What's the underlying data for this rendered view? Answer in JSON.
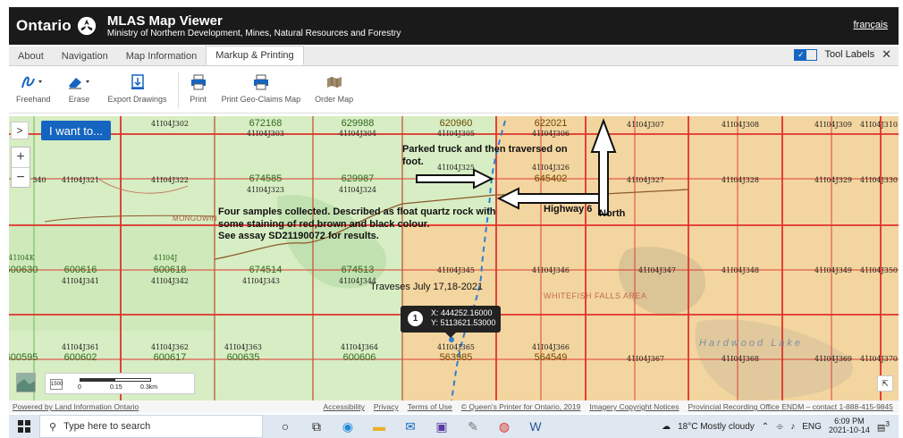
{
  "header": {
    "logo_text": "Ontario",
    "app_title": "MLAS Map Viewer",
    "subtitle": "Ministry of Northern Development, Mines, Natural Resources and Forestry",
    "language_link": "français"
  },
  "tabs": {
    "items": [
      {
        "label": "About"
      },
      {
        "label": "Navigation"
      },
      {
        "label": "Map Information"
      },
      {
        "label": "Markup & Printing"
      }
    ],
    "active": "Markup & Printing",
    "tool_labels": "Tool Labels",
    "tool_labels_checked": true,
    "close_glyph": "✕"
  },
  "toolbar": {
    "freehand": "Freehand",
    "erase": "Erase",
    "export_drawings": "Export Drawings",
    "print": "Print",
    "print_geo_claims": "Print Geo-Claims Map",
    "order_map": "Order Map"
  },
  "map": {
    "i_want_to": "I want to...",
    "expand_glyph": ">",
    "zoom_in": "+",
    "zoom_out": "−",
    "cells_row1": [
      "41I04J302",
      "41I04J303",
      "41I04J304",
      "41I04J305",
      "41I04J306",
      "41I04J307",
      "41I04J308",
      "41I04J309",
      "41I04J310"
    ],
    "claims_row1": [
      "672168",
      "629988",
      "620960",
      "622021"
    ],
    "cells_row2": [
      "340",
      "41I04J321",
      "41I04J322",
      "41I04J323",
      "41I04J324",
      "41I04J325",
      "41I04J326",
      "41I04J327",
      "41I04J328",
      "41I04J329",
      "41I04J330"
    ],
    "claims_row2": [
      "674585",
      "629987",
      "645402"
    ],
    "cells_row3": [
      "41I04J341",
      "41I04J342",
      "41I04J343",
      "41I04J344",
      "41I04J345",
      "41I04J346",
      "41I04J347",
      "41I04J348",
      "41I04J349",
      "41I04J350"
    ],
    "claims_row3": [
      "600630",
      "600616",
      "600618",
      "674514",
      "674513"
    ],
    "row3_prefix_a": "41I04K",
    "row3_prefix_b": "41I04J",
    "marker_num": "1",
    "cells_row4": [
      "41I04J361",
      "41I04J362",
      "41I04J363",
      "41I04J364",
      "41I04J365",
      "41I04J366",
      "41I04J367",
      "41I04J368",
      "41I04J369",
      "41I04J370"
    ],
    "claims_row4": [
      "600595",
      "600602",
      "600617",
      "600635",
      "600606",
      "563985",
      "564549"
    ],
    "place_moncowan": "MONGOWIN",
    "place_whitefish": "WHITEFISH FALLS AREA",
    "place_lake": "Hardwood Lake",
    "annotation_truck": "Parked truck and then traversed on foot.",
    "annotation_samples": "Four samples collected. Described as float quartz rock with some staining of red,brown and black colour.",
    "annotation_assay": "See assay SD21190072 for results.",
    "annotation_highway": "Highway 6",
    "annotation_north": "North",
    "annotation_traverses": "Traveses July 17,18-2021",
    "coord_x": "X: 444252.16000",
    "coord_y": "Y: 5113621.53000",
    "scale_0": "0",
    "scale_1": "0.15",
    "scale_2": "0.3km",
    "scale_icon": "1500",
    "reset_glyph": "⇱"
  },
  "footer": {
    "powered": "Powered by Land Information Ontario",
    "links": [
      "Accessibility",
      "Privacy",
      "Terms of Use",
      "© Queen's Printer for Ontario, 2019",
      "Imagery Copyright Notices",
      "Provincial Recording Office ENDM – contact 1-888-415-9845"
    ]
  },
  "taskbar": {
    "search_placeholder": "Type here to search",
    "weather": "18°C  Mostly cloudy",
    "lang": "ENG",
    "time": "6:09 PM",
    "date": "2021-10-14",
    "notif_count": "3"
  },
  "colors": {
    "header_bg": "#1a1a1a",
    "accent_blue": "#1565c0",
    "grid_red": "#e0312b",
    "map_green": "#d9efc6",
    "map_orange": "#f4d49a"
  }
}
